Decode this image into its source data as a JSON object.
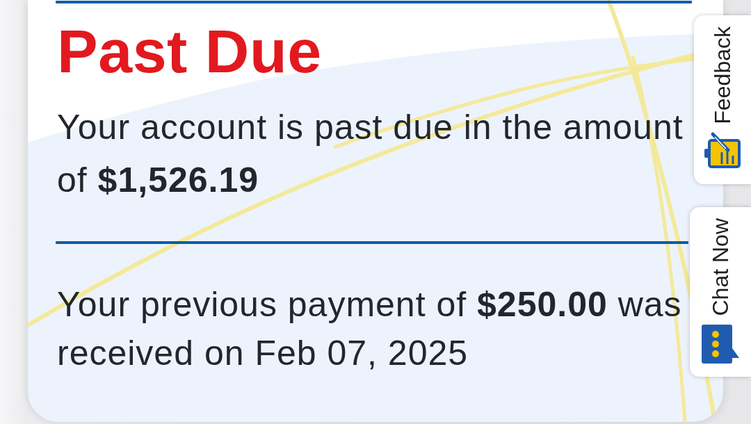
{
  "status": {
    "title": "Past Due",
    "message": "Your account is past due in the amount of **$1,526.19**"
  },
  "last_payment": {
    "message": "Your previous payment of **$250.00** was received on Feb 07, 2025"
  },
  "side_tabs": [
    {
      "label": "Feedback",
      "kind": "feedback"
    },
    {
      "label": "Chat Now",
      "kind": "chat"
    }
  ]
}
